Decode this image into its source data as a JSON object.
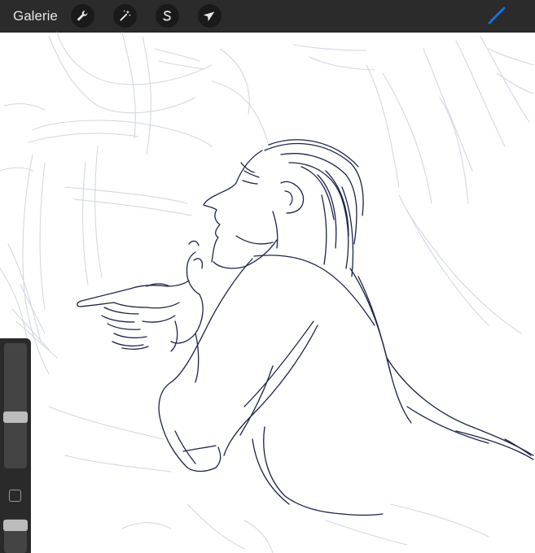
{
  "toolbar": {
    "gallery_label": "Galerie",
    "tools": [
      {
        "name": "actions",
        "icon": "wrench-icon"
      },
      {
        "name": "adjustments",
        "icon": "magic-wand-icon"
      },
      {
        "name": "selection",
        "icon": "selection-s-icon"
      },
      {
        "name": "transform",
        "icon": "arrow-cursor-icon"
      }
    ],
    "active_tool": {
      "name": "brush",
      "icon": "brush-icon",
      "color": "#1e6fe0"
    }
  },
  "canvas": {
    "sketch_color": "#1c2448",
    "background_sketch_color": "#d0d5df",
    "background": "#ffffff"
  },
  "sidebar": {
    "brush_size_level": 0.4,
    "opacity_level": 0.95,
    "modify_icon": "square-modify-icon"
  },
  "colors": {
    "toolbar_bg": "#2b2b2b",
    "sidebar_bg": "#2a2a2a",
    "accent": "#1e6fe0"
  }
}
